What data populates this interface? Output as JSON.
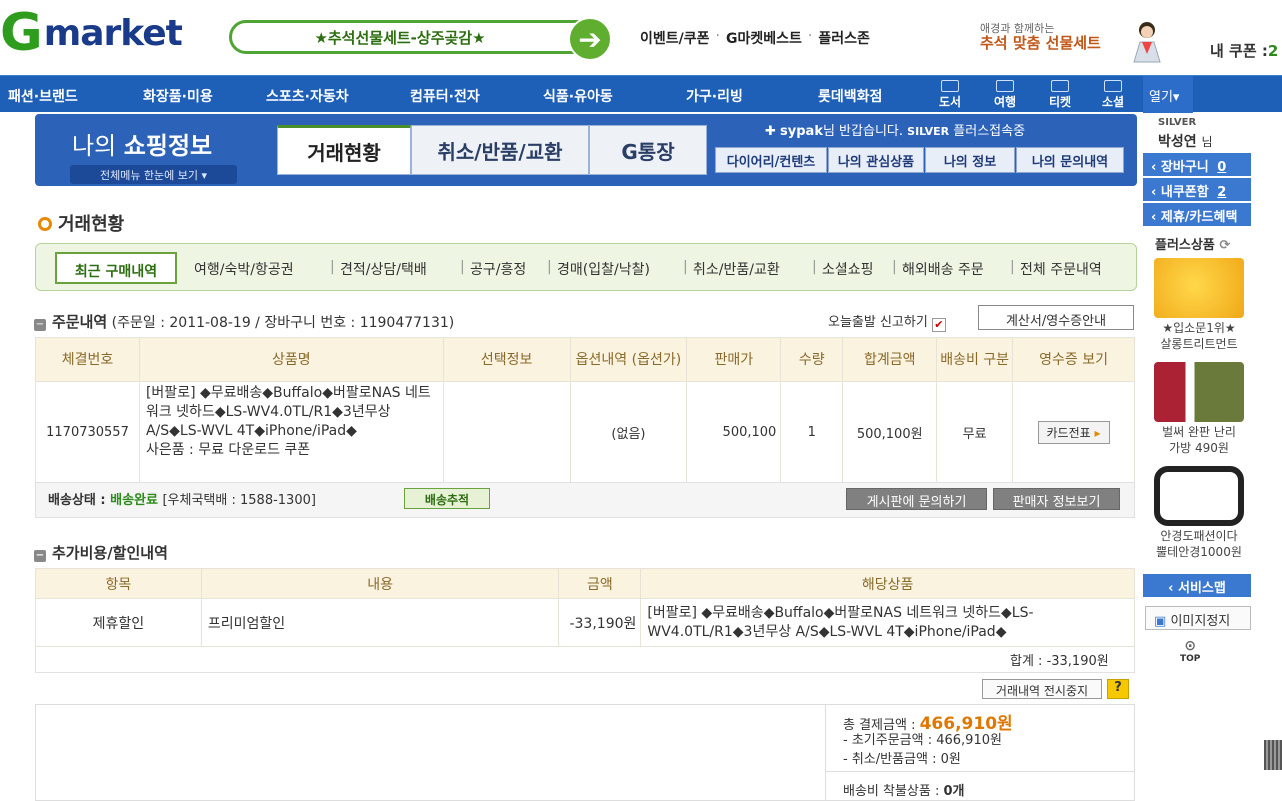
{
  "header": {
    "logo": "market",
    "banner": "★추석선물세트-상주곶감★",
    "top_links": [
      "이벤트/쿠폰",
      "G마켓베스트",
      "플러스존"
    ],
    "promo_small": "애경과 함께하는",
    "promo_big": "추석 맞춤 선물세트",
    "my_coupon_label": "내 쿠폰 :",
    "my_coupon_value": "2"
  },
  "nav": {
    "items": [
      "패션·브랜드",
      "화장품·미용",
      "스포츠·자동차",
      "컴퓨터·전자",
      "식품·유아동",
      "가구·리빙",
      "롯데백화점"
    ],
    "icons": [
      "도서",
      "여행",
      "티켓",
      "소셜"
    ],
    "more": "열기▾"
  },
  "myinfo": {
    "title_a": "나의 ",
    "title_b": "쇼핑정보",
    "all_menu": "전체메뉴 한눈에 보기 ▾",
    "tabs": [
      "거래현황",
      "취소/반품/교환",
      "G통장"
    ],
    "welcome_user": "sypak",
    "welcome_text": "님 반갑습니다.",
    "grade": "SILVER",
    "plus": "플러스접속중",
    "small_tabs": [
      "다이어리/컨텐츠",
      "나의 관심상품",
      "나의 정보",
      "나의 문의내역"
    ]
  },
  "sidebar": {
    "grade": "SILVER",
    "user": "박성연",
    "user_suffix": "님",
    "cart_label": "장바구니",
    "cart_count": "0",
    "coupon_label": "내쿠폰함",
    "coupon_count": "2",
    "benefit": "제휴/카드혜택",
    "plus_title": "플러스상품",
    "products": [
      {
        "l1": "★입소문1위★",
        "l2": "살롱트리트먼트"
      },
      {
        "l1": "벌써 완판 난리",
        "l2": "가방 490원"
      },
      {
        "l1": "안경도패션이다",
        "l2": "뿔테안경1000원"
      }
    ],
    "service_map": "서비스맵",
    "image_stop": "이미지정지",
    "top": "TOP"
  },
  "main": {
    "section_title": "거래현황",
    "subtabs_active": "최근 구매내역",
    "subtabs": [
      "여행/숙박/항공권",
      "견적/상담/택배",
      "공구/흥정",
      "경매(입찰/낙찰)",
      "취소/반품/교환",
      "소셜쇼핑",
      "해외배송 주문",
      "전체 주문내역"
    ],
    "order": {
      "title": "주문내역",
      "info": "(주문일 : 2011-08-19 / 장바구니 번호 : 1190477131)",
      "report": "오늘출발 신고하기",
      "receipt_guide": "계산서/영수증안내",
      "headers": [
        "체결번호",
        "상품명",
        "선택정보",
        "옵션내역 (옵션가)",
        "판매가",
        "수량",
        "합계금액",
        "배송비 구분",
        "영수증 보기"
      ],
      "row": {
        "no": "1170730557",
        "product": "[버팔로] ◆무료배송◆Buffalo◆버팔로NAS 네트워크 넷하드◆LS-WV4.0TL/R1◆3년무상 A/S◆LS-WVL 4T◆iPhone/iPad◆",
        "gift": "사은품 : 무료 다운로드 쿠폰",
        "select": "",
        "option": "(없음)",
        "price": "500,100",
        "qty": "1",
        "total": "500,100원",
        "ship": "무료",
        "receipt_btn": "카드전표"
      },
      "ship_label": "배송상태 :",
      "ship_status": "배송완료",
      "carrier": "[우체국택배 : 1588-1300]",
      "track_btn": "배송추적",
      "board_btn": "게시판에 문의하기",
      "seller_btn": "판매자 정보보기"
    },
    "extra": {
      "title": "추가비용/할인내역",
      "headers": [
        "항목",
        "내용",
        "금액",
        "해당상품"
      ],
      "row": {
        "item": "제휴할인",
        "content": "프리미엄할인",
        "amount": "-33,190원",
        "product": "[버팔로] ◆무료배송◆Buffalo◆버팔로NAS 네트워크 넷하드◆LS-WV4.0TL/R1◆3년무상 A/S◆LS-WVL 4T◆iPhone/iPad◆"
      },
      "sum": "합계 : -33,190원"
    },
    "hide_btn": "거래내역 전시중지",
    "help_btn": "?",
    "total": {
      "label": "총 결제금액 :",
      "amount": "466,910원",
      "initial": "- 초기주문금액 : 466,910원",
      "cancel": "- 취소/반품금액 : 0원",
      "cod_label": "배송비 착불상품 :",
      "cod_value": "0개"
    }
  }
}
